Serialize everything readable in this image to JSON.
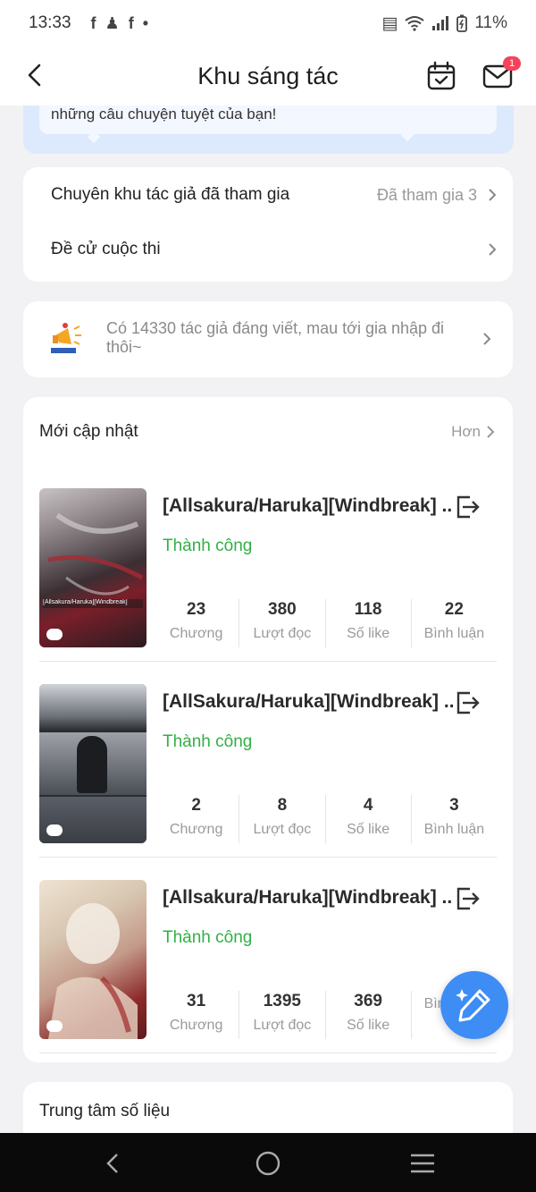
{
  "status_bar": {
    "time": "13:33",
    "battery": "11%"
  },
  "header": {
    "title": "Khu sáng tác",
    "mail_badge": "1"
  },
  "banner": {
    "text": "những câu chuyện tuyệt của bạn!"
  },
  "menu": [
    {
      "label": "Chuyên khu tác giả đã tham gia",
      "value": "Đã tham gia 3"
    },
    {
      "label": "Đề cử cuộc thi",
      "value": ""
    }
  ],
  "notice": {
    "text": "Có 14330 tác giả đáng viết, mau tới gia nhập đi thôi~"
  },
  "recent": {
    "title": "Mới cập nhật",
    "more_label": "Hơn",
    "stat_labels": [
      "Chương",
      "Lượt đọc",
      "Số like",
      "Bình luận"
    ],
    "stories": [
      {
        "title": "[Allsakura/Haruka][Windbreak] ...",
        "status": "Thành công",
        "stats": [
          "23",
          "380",
          "118",
          "22"
        ],
        "cover_text": "[Allsakura/Haruka][Windbreak]"
      },
      {
        "title": "[AllSakura/Haruka][Windbreak] ...",
        "status": "Thành công",
        "stats": [
          "2",
          "8",
          "4",
          "3"
        ],
        "cover_text": ""
      },
      {
        "title": "[Allsakura/Haruka][Windbreak] ...",
        "status": "Thành công",
        "stats": [
          "31",
          "1395",
          "369",
          ""
        ],
        "cover_text": ""
      }
    ]
  },
  "data_center": {
    "title": "Trung tâm số liệu"
  },
  "colors": {
    "accent_blue": "#3d8df5",
    "success_green": "#32b045",
    "badge_red": "#f4435a"
  }
}
